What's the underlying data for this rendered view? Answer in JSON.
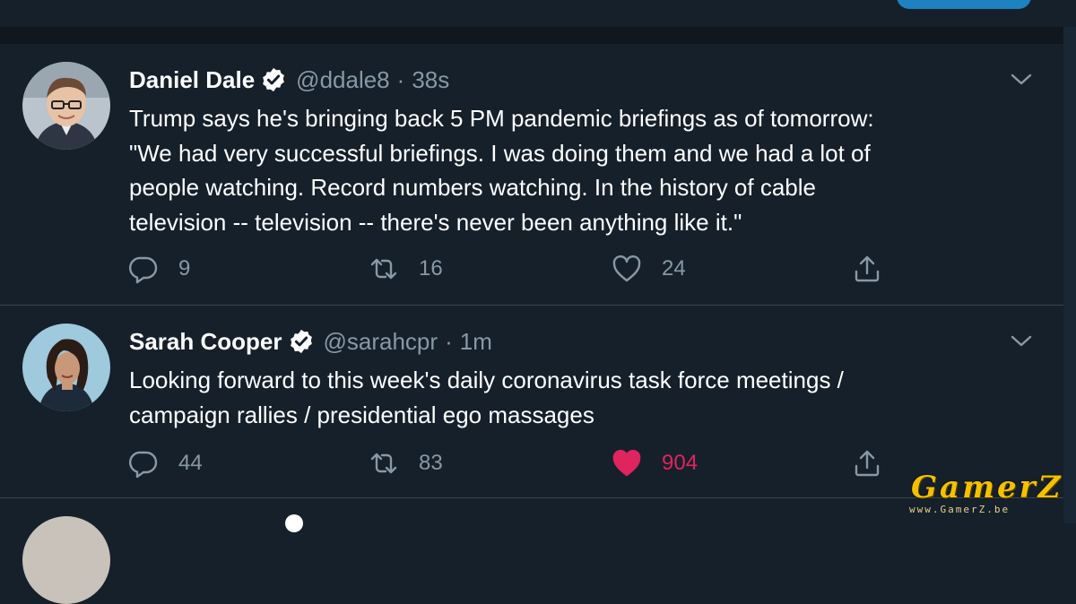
{
  "tweets": [
    {
      "name": "Daniel Dale",
      "handle": "@ddale8",
      "separator": "·",
      "time": "38s",
      "text": "Trump says he's bringing back 5 PM pandemic briefings as of tomorrow:\n\"We had very successful briefings. I was doing them and we had a lot of\npeople watching. Record numbers watching. In the history of cable\ntelevision -- television -- there's never been anything like it.\"",
      "replies": "9",
      "retweets": "16",
      "likes": "24",
      "liked": false
    },
    {
      "name": "Sarah Cooper",
      "handle": "@sarahcpr",
      "separator": "·",
      "time": "1m",
      "text": "Looking forward to this week's daily coronavirus task force meetings /\ncampaign rallies / presidential ego massages",
      "replies": "44",
      "retweets": "83",
      "likes": "904",
      "liked": true
    }
  ],
  "watermark": {
    "brand": "GamerZ",
    "url": "www.GamerZ.be"
  },
  "colors": {
    "background": "#15202b",
    "muted": "#8899a6",
    "like_active": "#e0245e",
    "verified": "#ffffff"
  },
  "icons": [
    "verified-badge-icon",
    "chevron-down-icon",
    "reply-icon",
    "retweet-icon",
    "like-icon",
    "share-icon"
  ]
}
